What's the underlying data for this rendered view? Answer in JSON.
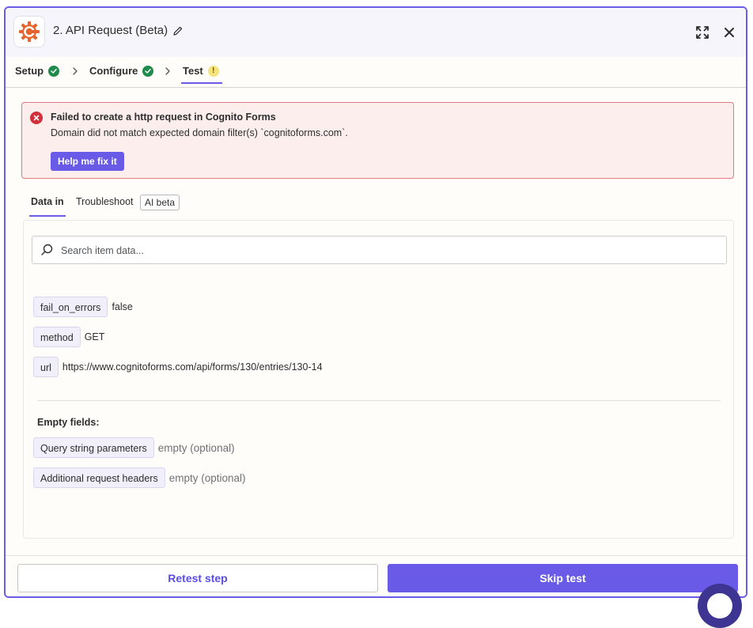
{
  "header": {
    "title": "2. API Request (Beta)",
    "icons": {
      "app": "cog-app-icon",
      "edit": "pencil-icon",
      "expand": "expand-icon",
      "close": "close-icon"
    },
    "brand_color": "#e8622c"
  },
  "steps": {
    "setup": "Setup",
    "configure": "Configure",
    "test": "Test",
    "setup_status": "complete",
    "configure_status": "complete",
    "test_status": "warning",
    "warning_glyph": "!"
  },
  "error": {
    "title": "Failed to create a http request in Cognito Forms",
    "message": "Domain did not match expected domain filter(s) `cognitoforms.com`.",
    "fix_button": "Help me fix it",
    "color": "#d1303a"
  },
  "subtabs": {
    "data_in": "Data in",
    "troubleshoot": "Troubleshoot",
    "badge": "AI beta"
  },
  "search": {
    "placeholder": "Search item data..."
  },
  "fields": [
    {
      "key": "fail_on_errors",
      "value": "false"
    },
    {
      "key": "method",
      "value": "GET"
    },
    {
      "key": "url",
      "value": "https://www.cognitoforms.com/api/forms/130/entries/130-14"
    }
  ],
  "empty_fields": {
    "title": "Empty fields:",
    "items": [
      {
        "key": "Query string parameters",
        "value": "empty (optional)"
      },
      {
        "key": "Additional request headers",
        "value": "empty (optional)"
      }
    ]
  },
  "footer": {
    "retest": "Retest step",
    "skip": "Skip test"
  },
  "accent_color": "#695be8"
}
